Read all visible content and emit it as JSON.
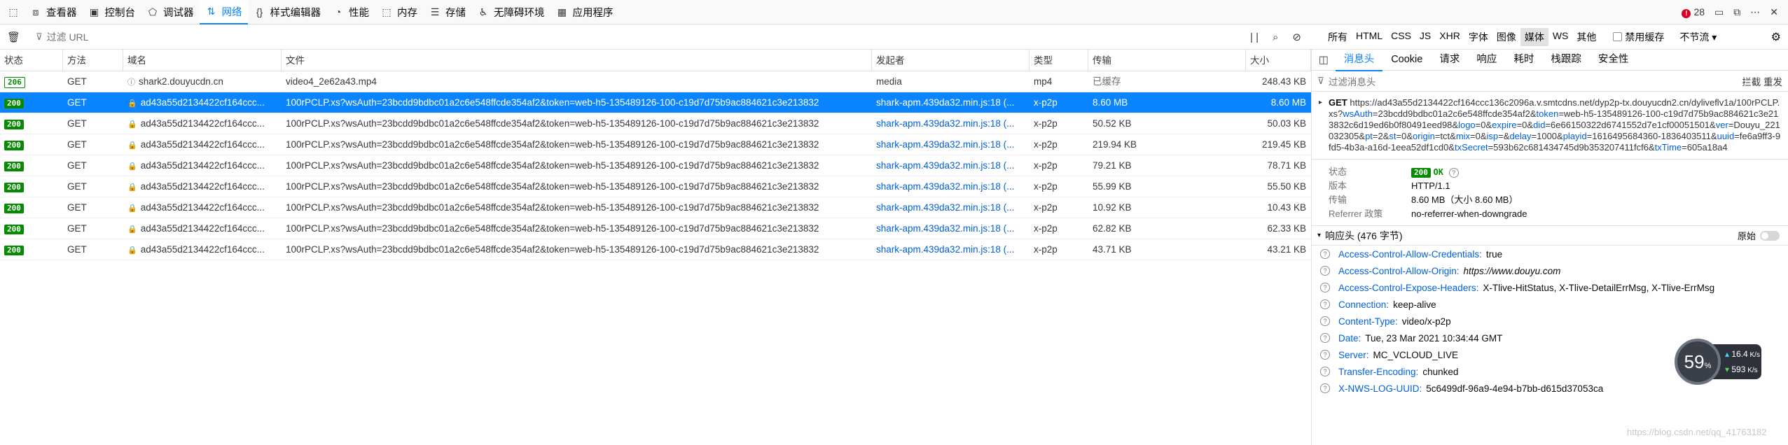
{
  "toolbar": {
    "tools": [
      {
        "icon": "inspector-icon",
        "glyph": "⧈",
        "label": "查看器"
      },
      {
        "icon": "console-icon",
        "glyph": "▣",
        "label": "控制台"
      },
      {
        "icon": "debugger-icon",
        "glyph": "⬠",
        "label": "调试器"
      },
      {
        "icon": "network-icon",
        "glyph": "⇅",
        "label": "网络"
      },
      {
        "icon": "style-editor-icon",
        "glyph": "{}",
        "label": "样式编辑器"
      },
      {
        "icon": "performance-icon",
        "glyph": "◔",
        "label": "性能"
      },
      {
        "icon": "memory-icon",
        "glyph": "⬚",
        "label": "内存"
      },
      {
        "icon": "storage-icon",
        "glyph": "☰",
        "label": "存储"
      },
      {
        "icon": "accessibility-icon",
        "glyph": "♿",
        "label": "无障碍环境"
      },
      {
        "icon": "application-icon",
        "glyph": "▦",
        "label": "应用程序"
      }
    ],
    "error_count": "28"
  },
  "filter": {
    "placeholder": "过滤 URL",
    "pause_icon": "| |",
    "search_icon": "⌕",
    "block_icon": "⊘"
  },
  "type_filters": [
    "所有",
    "HTML",
    "CSS",
    "JS",
    "XHR",
    "字体",
    "图像",
    "媒体",
    "WS",
    "其他"
  ],
  "type_filter_active": "媒体",
  "disable_cache_label": "禁用缓存",
  "throttle_label": "不节流",
  "table": {
    "headers": [
      "状态",
      "方法",
      "域名",
      "文件",
      "发起者",
      "类型",
      "传输",
      "大小"
    ],
    "rows": [
      {
        "status": "206",
        "method": "GET",
        "domain": "shark2.douyucdn.cn",
        "file": "video4_2e62a43.mp4",
        "initiator": "media",
        "type": "mp4",
        "transfer": "已缓存",
        "size": "248.43 KB",
        "cached": true
      },
      {
        "status": "200",
        "method": "GET",
        "domain": "ad43a55d2134422cf164ccc...",
        "file": "100rPCLP.xs?wsAuth=23bcdd9bdbc01a2c6e548ffcde354af2&token=web-h5-135489126-100-c19d7d75b9ac884621c3e213832",
        "initiator": "shark-apm.439da32.min.js:18 (...",
        "type": "x-p2p",
        "transfer": "8.60 MB",
        "size": "8.60 MB",
        "selected": true
      },
      {
        "status": "200",
        "method": "GET",
        "domain": "ad43a55d2134422cf164ccc...",
        "file": "100rPCLP.xs?wsAuth=23bcdd9bdbc01a2c6e548ffcde354af2&token=web-h5-135489126-100-c19d7d75b9ac884621c3e213832",
        "initiator": "shark-apm.439da32.min.js:18 (...",
        "type": "x-p2p",
        "transfer": "50.52 KB",
        "size": "50.03 KB"
      },
      {
        "status": "200",
        "method": "GET",
        "domain": "ad43a55d2134422cf164ccc...",
        "file": "100rPCLP.xs?wsAuth=23bcdd9bdbc01a2c6e548ffcde354af2&token=web-h5-135489126-100-c19d7d75b9ac884621c3e213832",
        "initiator": "shark-apm.439da32.min.js:18 (...",
        "type": "x-p2p",
        "transfer": "219.94 KB",
        "size": "219.45 KB"
      },
      {
        "status": "200",
        "method": "GET",
        "domain": "ad43a55d2134422cf164ccc...",
        "file": "100rPCLP.xs?wsAuth=23bcdd9bdbc01a2c6e548ffcde354af2&token=web-h5-135489126-100-c19d7d75b9ac884621c3e213832",
        "initiator": "shark-apm.439da32.min.js:18 (...",
        "type": "x-p2p",
        "transfer": "79.21 KB",
        "size": "78.71 KB"
      },
      {
        "status": "200",
        "method": "GET",
        "domain": "ad43a55d2134422cf164ccc...",
        "file": "100rPCLP.xs?wsAuth=23bcdd9bdbc01a2c6e548ffcde354af2&token=web-h5-135489126-100-c19d7d75b9ac884621c3e213832",
        "initiator": "shark-apm.439da32.min.js:18 (...",
        "type": "x-p2p",
        "transfer": "55.99 KB",
        "size": "55.50 KB"
      },
      {
        "status": "200",
        "method": "GET",
        "domain": "ad43a55d2134422cf164ccc...",
        "file": "100rPCLP.xs?wsAuth=23bcdd9bdbc01a2c6e548ffcde354af2&token=web-h5-135489126-100-c19d7d75b9ac884621c3e213832",
        "initiator": "shark-apm.439da32.min.js:18 (...",
        "type": "x-p2p",
        "transfer": "10.92 KB",
        "size": "10.43 KB"
      },
      {
        "status": "200",
        "method": "GET",
        "domain": "ad43a55d2134422cf164ccc...",
        "file": "100rPCLP.xs?wsAuth=23bcdd9bdbc01a2c6e548ffcde354af2&token=web-h5-135489126-100-c19d7d75b9ac884621c3e213832",
        "initiator": "shark-apm.439da32.min.js:18 (...",
        "type": "x-p2p",
        "transfer": "62.82 KB",
        "size": "62.33 KB"
      },
      {
        "status": "200",
        "method": "GET",
        "domain": "ad43a55d2134422cf164ccc...",
        "file": "100rPCLP.xs?wsAuth=23bcdd9bdbc01a2c6e548ffcde354af2&token=web-h5-135489126-100-c19d7d75b9ac884621c3e213832",
        "initiator": "shark-apm.439da32.min.js:18 (...",
        "type": "x-p2p",
        "transfer": "43.71 KB",
        "size": "43.21 KB"
      }
    ]
  },
  "panel": {
    "tabs": [
      "消息头",
      "Cookie",
      "请求",
      "响应",
      "耗时",
      "栈跟踪",
      "安全性"
    ],
    "active_tab": "消息头",
    "filter_placeholder": "过滤消息头",
    "filter_opts": "拦截  重发",
    "method": "GET",
    "url_parts": [
      {
        "t": "https://ad43a55d2134422cf164ccc136c2096a.v.smtcdns.net/dyp2p-tx.douyucdn2.cn/dyliveflv1a/100rPCLP.xs?",
        "k": false
      },
      {
        "t": "wsAuth",
        "k": true
      },
      {
        "t": "=23bcdd9bdbc01a2c6e548ffcde354af2&",
        "k": false
      },
      {
        "t": "token",
        "k": true
      },
      {
        "t": "=web-h5-135489126-100-c19d7d75b9ac884621c3e213832c6d19ed6b0f80491eed98&",
        "k": false
      },
      {
        "t": "logo",
        "k": true
      },
      {
        "t": "=0&",
        "k": false
      },
      {
        "t": "expire",
        "k": true
      },
      {
        "t": "=0&",
        "k": false
      },
      {
        "t": "did",
        "k": true
      },
      {
        "t": "=6e66150322d6741552d7e1cf00051501&",
        "k": false
      },
      {
        "t": "ver",
        "k": true
      },
      {
        "t": "=Douyu_221032305&",
        "k": false
      },
      {
        "t": "pt",
        "k": true
      },
      {
        "t": "=2&",
        "k": false
      },
      {
        "t": "st",
        "k": true
      },
      {
        "t": "=0&",
        "k": false
      },
      {
        "t": "origin",
        "k": true
      },
      {
        "t": "=tct&",
        "k": false
      },
      {
        "t": "mix",
        "k": true
      },
      {
        "t": "=0&",
        "k": false
      },
      {
        "t": "isp",
        "k": true
      },
      {
        "t": "=&",
        "k": false
      },
      {
        "t": "delay",
        "k": true
      },
      {
        "t": "=1000&",
        "k": false
      },
      {
        "t": "playid",
        "k": true
      },
      {
        "t": "=1616495684360-1836403511&",
        "k": false
      },
      {
        "t": "uuid",
        "k": true
      },
      {
        "t": "=fe6a9ff3-9fd5-4b3a-a16d-1eea52df1cd0&",
        "k": false
      },
      {
        "t": "txSecret",
        "k": true
      },
      {
        "t": "=593b62c681434745d9b353207411fcf6&",
        "k": false
      },
      {
        "t": "txTime",
        "k": true
      },
      {
        "t": "=605a18a4",
        "k": false
      }
    ],
    "summary": {
      "status_label": "状态",
      "status_code": "200",
      "status_text": "OK",
      "version_label": "版本",
      "version": "HTTP/1.1",
      "transfer_label": "传输",
      "transfer": "8.60 MB（大小 8.60 MB）",
      "referrer_label": "Referrer 政策",
      "referrer": "no-referrer-when-downgrade"
    },
    "response_headers_title": "响应头 (476 字节)",
    "raw_label": "原始",
    "headers": [
      {
        "k": "Access-Control-Allow-Credentials:",
        "v": "true"
      },
      {
        "k": "Access-Control-Allow-Origin:",
        "v": "https://www.douyu.com",
        "it": true
      },
      {
        "k": "Access-Control-Expose-Headers:",
        "v": "X-Tlive-HitStatus, X-Tlive-DetailErrMsg, X-Tlive-ErrMsg"
      },
      {
        "k": "Connection:",
        "v": "keep-alive"
      },
      {
        "k": "Content-Type:",
        "v": "video/x-p2p"
      },
      {
        "k": "Date:",
        "v": "Tue, 23 Mar 2021 10:34:44 GMT"
      },
      {
        "k": "Server:",
        "v": "MC_VCLOUD_LIVE"
      },
      {
        "k": "Transfer-Encoding:",
        "v": "chunked"
      },
      {
        "k": "X-NWS-LOG-UUID:",
        "v": "5c6499df-96a9-4e94-b7bb-d615d37053ca"
      }
    ]
  },
  "speed_widget": {
    "percent": "59",
    "unit": "%",
    "up": "16.4",
    "down": "593",
    "rate_unit": "K/s"
  },
  "watermark": "https://blog.csdn.net/qq_41763182"
}
